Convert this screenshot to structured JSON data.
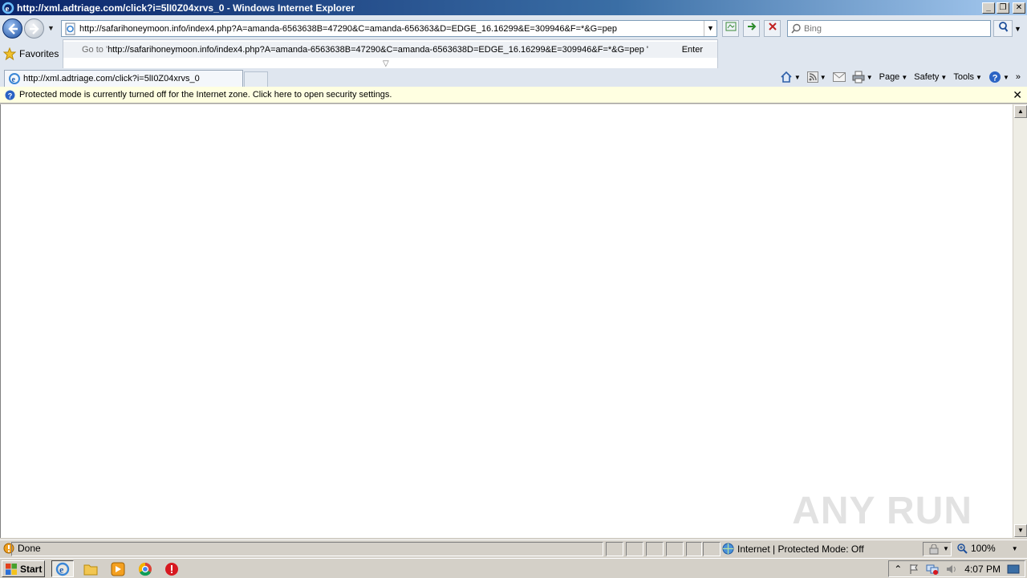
{
  "window": {
    "title": "http://xml.adtriage.com/click?i=5lI0Z04xrvs_0 - Windows Internet Explorer",
    "minimize": "_",
    "restore": "❐",
    "close": "✕"
  },
  "address_bar": {
    "value": "http://safarihoneymoon.info/index4.php?A=amanda-6563638B=47290&C=amanda-656363&D=EDGE_16.16299&E=309946&F=*&G=pep"
  },
  "search": {
    "placeholder": "Bing"
  },
  "autocomplete": {
    "goto_label": "Go to '",
    "url": "http://safarihoneymoon.info/index4.php?A=amanda-6563638B=47290&C=amanda-6563638D=EDGE_16.16299&E=309946&F=*&G=pep '",
    "enter_label": "Enter"
  },
  "favorites": {
    "label": "Favorites"
  },
  "tabs": [
    {
      "label": "http://xml.adtriage.com/click?i=5lI0Z04xrvs_0"
    }
  ],
  "command_bar": {
    "page": "Page",
    "safety": "Safety",
    "tools": "Tools",
    "more": "»"
  },
  "info_bar": {
    "message": "Protected mode is currently turned off for the Internet zone.  Click here to open security settings.",
    "close": "✕"
  },
  "status_bar": {
    "status": "Done",
    "zone": "Internet | Protected Mode: Off",
    "zoom": "100%"
  },
  "taskbar": {
    "start": "Start",
    "clock": "4:07 PM"
  },
  "watermark": "ANY RUN",
  "colors": {
    "titlebar_start": "#0a246a",
    "infobar_bg": "#ffffe1",
    "chrome_bg": "#dfe6ef"
  }
}
